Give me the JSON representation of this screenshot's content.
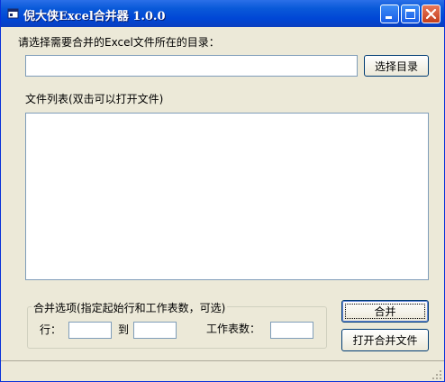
{
  "window": {
    "title": "倪大侠Excel合并器 1.0.0",
    "controls": [
      "minimize-icon",
      "maximize-icon",
      "close-icon"
    ]
  },
  "directory": {
    "prompt": "请选择需要合并的Excel文件所在的目录：",
    "path_value": "",
    "browse_label": "选择目录"
  },
  "file_list": {
    "label": "文件列表(双击可以打开文件)",
    "items": []
  },
  "options": {
    "group_title": "合并选项(指定起始行和工作表数，可选)",
    "row_label": "行：",
    "to_label": "到",
    "sheets_label": "工作表数：",
    "row_from": "",
    "row_to": "",
    "sheet_count": ""
  },
  "actions": {
    "merge_label": "合并",
    "open_merged_label": "打开合并文件"
  },
  "colors": {
    "titlebar": "#0a5ad9",
    "window_bg": "#ece9d8",
    "close_button": "#c33d1c"
  }
}
